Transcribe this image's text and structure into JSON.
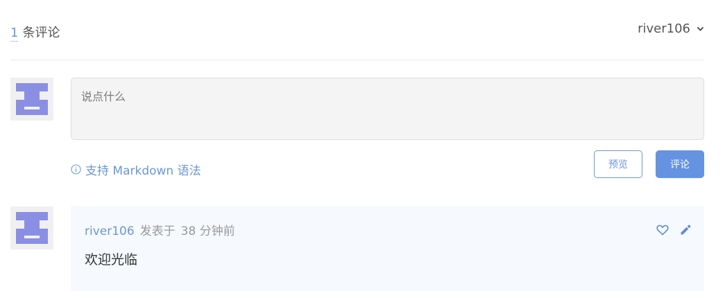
{
  "header": {
    "comment_count": "1",
    "comment_count_suffix": "条评论",
    "username": "river106"
  },
  "editor": {
    "placeholder": "说点什么",
    "markdown_hint": "支持 Markdown 语法",
    "preview_label": "预览",
    "submit_label": "评论"
  },
  "comments": [
    {
      "author": "river106",
      "verb": "发表于",
      "time": "38 分钟前",
      "body": "欢迎光临"
    }
  ],
  "icons": {
    "dropdown": "chevron-down-icon",
    "info": "info-circle-icon",
    "like": "heart-outline-icon",
    "edit": "pencil-icon"
  },
  "colors": {
    "accent": "#6a97d8",
    "button": "#6593e2",
    "avatar": "#8b8fe3",
    "comment_bg": "#f6f9fe"
  }
}
